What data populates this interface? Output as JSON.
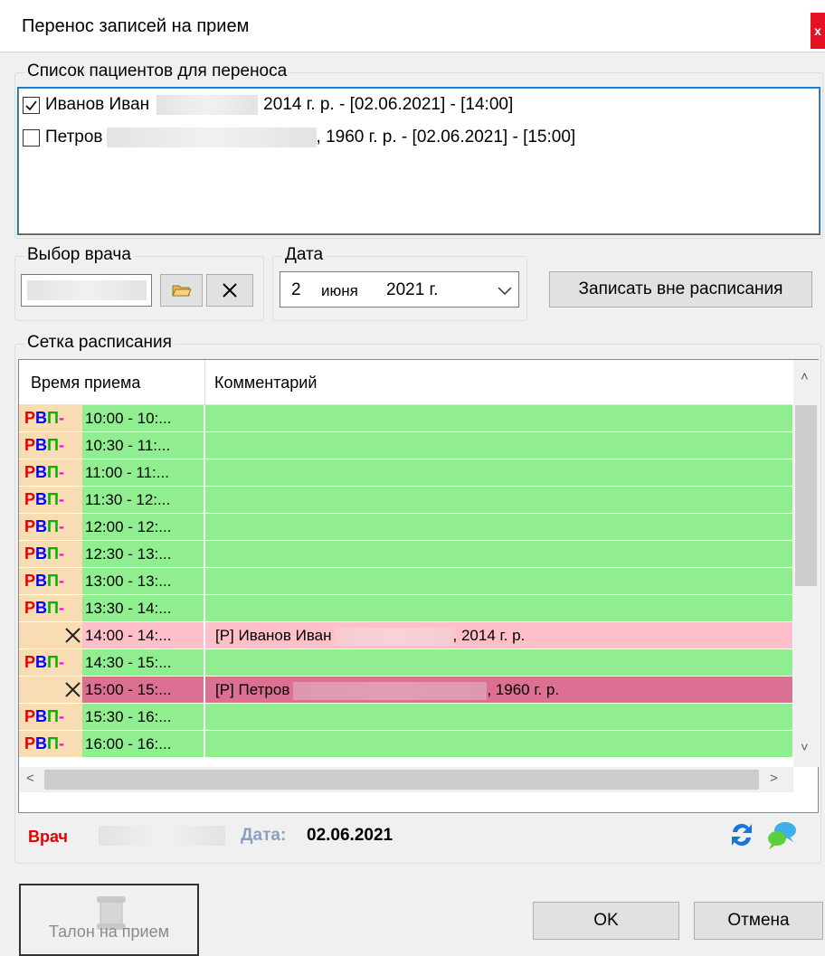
{
  "window": {
    "title": "Перенос записей на прием",
    "close": "x"
  },
  "patients": {
    "label": "Список пациентов для переноса",
    "items": [
      {
        "checked": true,
        "name": "Иванов Иван",
        "suffix": "2014 г. р. - [02.06.2021] - [14:00]"
      },
      {
        "checked": false,
        "name": "Петров",
        "suffix": ", 1960 г. р. - [02.06.2021] - [15:00]"
      }
    ]
  },
  "doctor": {
    "label": "Выбор врача",
    "value": ""
  },
  "date": {
    "label": "Дата",
    "day": "2",
    "month": "июня",
    "year": "2021 г."
  },
  "unscheduled_button": "Записать вне расписания",
  "schedule": {
    "label": "Сетка расписания",
    "columns": [
      "Время приема",
      "Комментарий"
    ],
    "status_letters": {
      "r": "Р",
      "v": "В",
      "p": "П",
      "dash": "-"
    },
    "rows": [
      {
        "status": "rvp",
        "time": "10:00 - 10:...",
        "comment": "",
        "color": "#90ee90"
      },
      {
        "status": "rvp",
        "time": "10:30 - 11:...",
        "comment": "",
        "color": "#90ee90"
      },
      {
        "status": "rvp",
        "time": "11:00 - 11:...",
        "comment": "",
        "color": "#90ee90"
      },
      {
        "status": "rvp",
        "time": "11:30 - 12:...",
        "comment": "",
        "color": "#90ee90"
      },
      {
        "status": "rvp",
        "time": "12:00 - 12:...",
        "comment": "",
        "color": "#90ee90"
      },
      {
        "status": "rvp",
        "time": "12:30 - 13:...",
        "comment": "",
        "color": "#90ee90"
      },
      {
        "status": "rvp",
        "time": "13:00 - 13:...",
        "comment": "",
        "color": "#90ee90"
      },
      {
        "status": "rvp",
        "time": "13:30 - 14:...",
        "comment": "",
        "color": "#90ee90"
      },
      {
        "status": "busy",
        "time": "14:00 - 14:...",
        "comment": "[Р] Иванов Иван",
        "comment_suffix": ", 2014 г. р.",
        "color": "#ffc0cb"
      },
      {
        "status": "rvp",
        "time": "14:30 - 15:...",
        "comment": "",
        "color": "#90ee90"
      },
      {
        "status": "busy",
        "time": "15:00 - 15:...",
        "comment": "[Р] Петров",
        "comment_suffix": ", 1960 г. р.",
        "color": "#db7093"
      },
      {
        "status": "rvp",
        "time": "15:30 - 16:...",
        "comment": "",
        "color": "#90ee90"
      },
      {
        "status": "rvp",
        "time": "16:00 - 16:...",
        "comment": "",
        "color": "#90ee90"
      }
    ]
  },
  "footer": {
    "doctor_label": "Врач",
    "date_label": "Дата:",
    "date_value": "02.06.2021"
  },
  "buttons": {
    "ticket": "Талон на прием",
    "ok": "OK",
    "cancel": "Отмена"
  },
  "colors": {
    "free": "#90ee90",
    "busy_light": "#ffc0cb",
    "busy_dark": "#db7093",
    "status_bg": "#f7dcb4",
    "accent": "#0078d7"
  }
}
